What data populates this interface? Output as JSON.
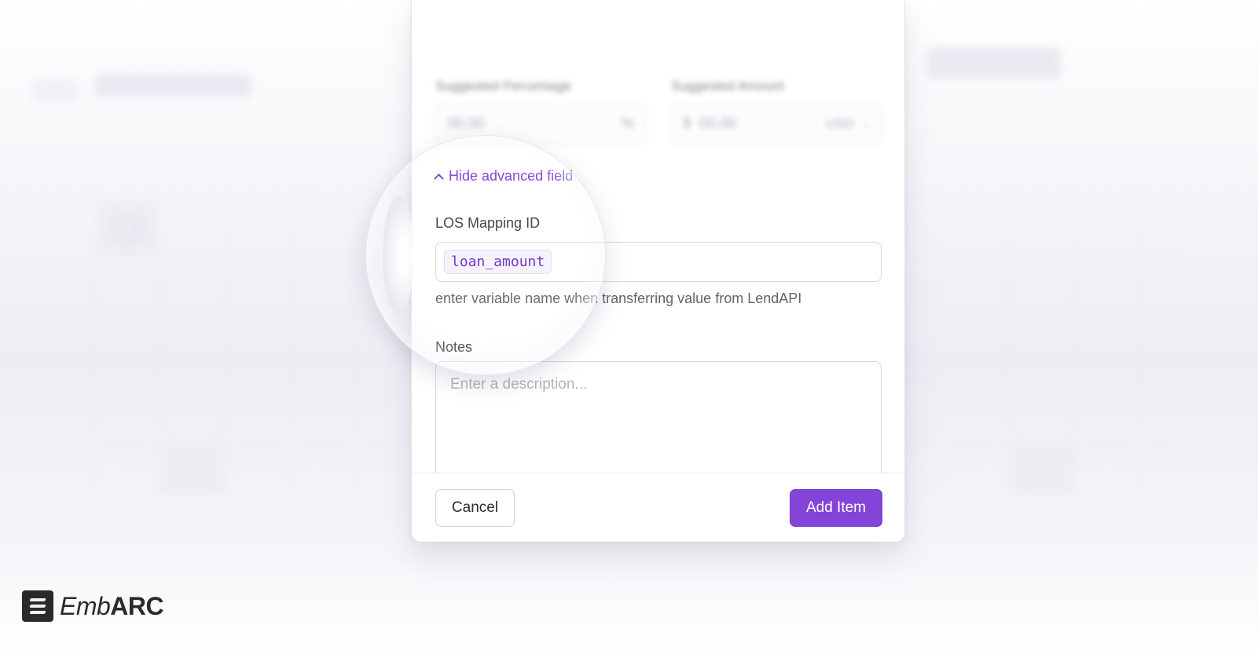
{
  "modal": {
    "top_row": {
      "left_text": "",
      "right_text": ""
    },
    "suggested_percentage": {
      "label": "Suggested Percentage",
      "value": "00.00",
      "suffix": "%"
    },
    "suggested_amount": {
      "label": "Suggested Amount",
      "prefix": "$",
      "value": "00.00",
      "currency": "USD"
    },
    "advanced_toggle": {
      "label": "Hide advanced field"
    },
    "los_mapping": {
      "label": "LOS Mapping ID",
      "value": "loan_amount",
      "hint": "enter variable name when transferring value from LendAPI"
    },
    "notes": {
      "label": "Notes",
      "placeholder": "Enter a description..."
    },
    "footer": {
      "cancel_label": "Cancel",
      "add_label": "Add Item"
    }
  },
  "logo": {
    "part1": "Emb",
    "part2": "ARC"
  },
  "colors": {
    "accent": "#8544d8",
    "link": "#7b3fd9",
    "chip_text": "#6a2fc9"
  },
  "icons": [
    "chevron-up-icon",
    "chevron-down-icon",
    "embarc-logo-icon"
  ]
}
